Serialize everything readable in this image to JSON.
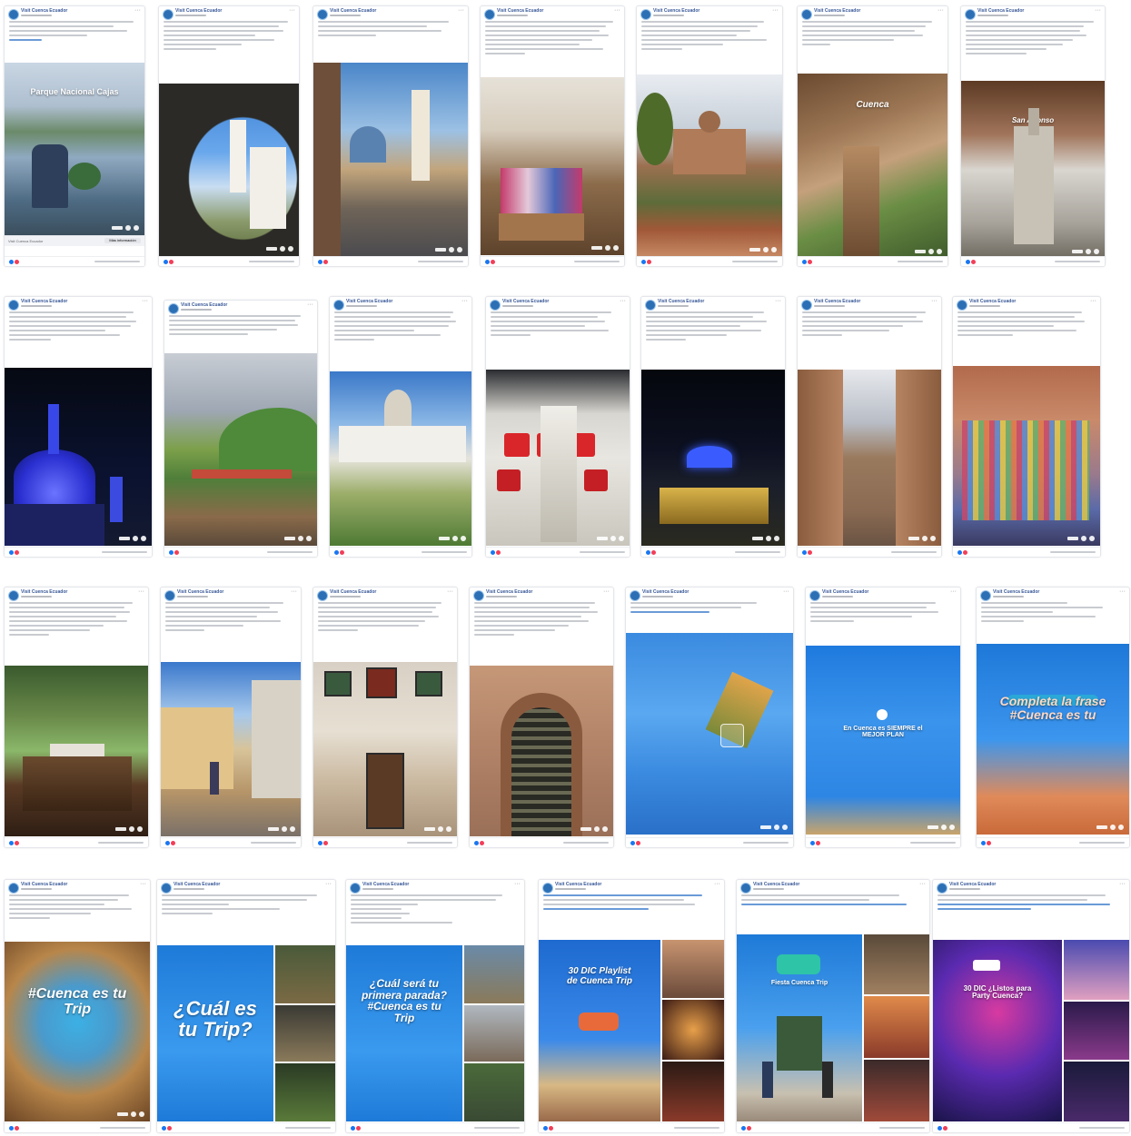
{
  "page": {
    "name": "Visit Cuenca Ecuador"
  },
  "posts": [
    {
      "page_name": "Visit Cuenca Ecuador",
      "overlay": "Parque Nacional Cajas",
      "link_label": "Visit Cuenca Ecuador",
      "link_button": "Más información"
    },
    {
      "page_name": "Visit Cuenca Ecuador",
      "overlay": ""
    },
    {
      "page_name": "Visit Cuenca Ecuador",
      "overlay": ""
    },
    {
      "page_name": "Visit Cuenca Ecuador",
      "overlay": ""
    },
    {
      "page_name": "Visit Cuenca Ecuador",
      "overlay": ""
    },
    {
      "page_name": "Visit Cuenca Ecuador",
      "overlay": "Cuenca"
    },
    {
      "page_name": "Visit Cuenca Ecuador",
      "overlay": "San Alfonso"
    },
    {
      "page_name": "Visit Cuenca Ecuador",
      "overlay": ""
    },
    {
      "page_name": "Visit Cuenca Ecuador",
      "overlay": ""
    },
    {
      "page_name": "Visit Cuenca Ecuador",
      "overlay": ""
    },
    {
      "page_name": "Visit Cuenca Ecuador",
      "overlay": ""
    },
    {
      "page_name": "Visit Cuenca Ecuador",
      "overlay": ""
    },
    {
      "page_name": "Visit Cuenca Ecuador",
      "overlay": ""
    },
    {
      "page_name": "Visit Cuenca Ecuador",
      "overlay": ""
    },
    {
      "page_name": "Visit Cuenca Ecuador",
      "overlay": ""
    },
    {
      "page_name": "Visit Cuenca Ecuador",
      "overlay": ""
    },
    {
      "page_name": "Visit Cuenca Ecuador",
      "overlay": ""
    },
    {
      "page_name": "Visit Cuenca Ecuador",
      "overlay": ""
    },
    {
      "page_name": "Visit Cuenca Ecuador",
      "overlay": ""
    },
    {
      "page_name": "Visit Cuenca Ecuador",
      "overlay": "En Cuenca es SIEMPRE el MEJOR PLAN"
    },
    {
      "page_name": "Visit Cuenca Ecuador",
      "overlay": "Completa la frase #Cuenca es tu"
    },
    {
      "page_name": "Visit Cuenca Ecuador",
      "overlay": "#Cuenca es tu Trip"
    },
    {
      "page_name": "Visit Cuenca Ecuador",
      "overlay": "¿Cuál es tu Trip?"
    },
    {
      "page_name": "Visit Cuenca Ecuador",
      "overlay": "¿Cuál será tu primera parada? #Cuenca es tu Trip"
    },
    {
      "page_name": "Visit Cuenca Ecuador",
      "overlay": "30 DIC Playlist de Cuenca Trip"
    },
    {
      "page_name": "Visit Cuenca Ecuador",
      "overlay": "Fiesta Cuenca Trip"
    },
    {
      "page_name": "Visit Cuenca Ecuador",
      "overlay": "30 DIC ¿Listos para Party Cuenca?"
    }
  ]
}
